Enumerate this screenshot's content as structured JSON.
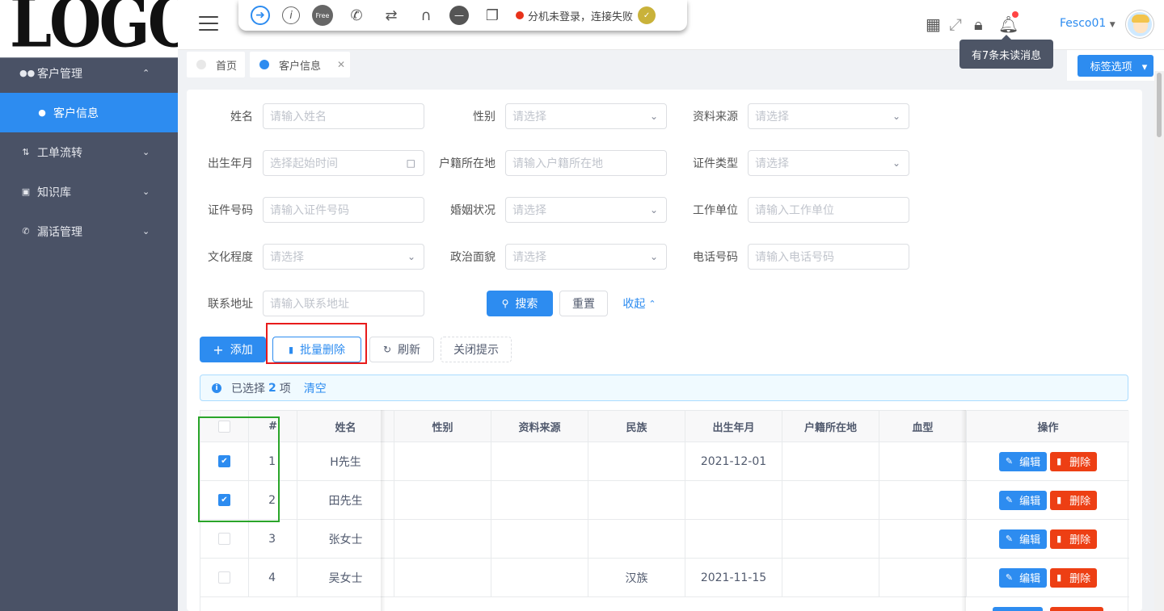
{
  "logo": "LOGO",
  "sidebar": {
    "items": [
      {
        "label": "客户管理",
        "icon": "users-icon"
      },
      {
        "label": "客户信息",
        "icon": "user-plus-icon"
      },
      {
        "label": "工单流转",
        "icon": "transfer-icon"
      },
      {
        "label": "知识库",
        "icon": "book-icon"
      },
      {
        "label": "漏话管理",
        "icon": "phone-icon"
      }
    ]
  },
  "phonebar": {
    "status": "分机未登录，连接失败",
    "free_label": "Free"
  },
  "header": {
    "user": "Fesco01",
    "tooltip": "有7条未读消息"
  },
  "tabs": [
    {
      "label": "首页"
    },
    {
      "label": "客户信息"
    }
  ],
  "tag_options": "标签选项",
  "form": {
    "name": {
      "label": "姓名",
      "placeholder": "请输入姓名"
    },
    "gender": {
      "label": "性别",
      "placeholder": "请选择"
    },
    "source": {
      "label": "资料来源",
      "placeholder": "请选择"
    },
    "birth": {
      "label": "出生年月",
      "placeholder": "选择起始时间"
    },
    "hukou": {
      "label": "户籍所在地",
      "placeholder": "请输入户籍所在地"
    },
    "idtype": {
      "label": "证件类型",
      "placeholder": "请选择"
    },
    "idno": {
      "label": "证件号码",
      "placeholder": "请输入证件号码"
    },
    "marital": {
      "label": "婚姻状况",
      "placeholder": "请选择"
    },
    "work": {
      "label": "工作单位",
      "placeholder": "请输入工作单位"
    },
    "edu": {
      "label": "文化程度",
      "placeholder": "请选择"
    },
    "politics": {
      "label": "政治面貌",
      "placeholder": "请选择"
    },
    "phone": {
      "label": "电话号码",
      "placeholder": "请输入电话号码"
    },
    "address": {
      "label": "联系地址",
      "placeholder": "请输入联系地址"
    },
    "search": "搜索",
    "reset": "重置",
    "collapse": "收起"
  },
  "toolbar": {
    "add": "添加",
    "batch_delete": "批量删除",
    "refresh": "刷新",
    "close_tip": "关闭提示"
  },
  "alert": {
    "prefix": "已选择",
    "count": "2",
    "suffix": "项",
    "clear": "清空"
  },
  "table": {
    "columns": [
      "#",
      "姓名",
      "性别",
      "资料来源",
      "民族",
      "出生年月",
      "户籍所在地",
      "血型",
      "操作"
    ],
    "edit": "编辑",
    "delete": "删除",
    "rows": [
      {
        "idx": "1",
        "name": "H先生",
        "gender": "",
        "source": "",
        "nation": "",
        "birth": "2021-12-01",
        "hukou": "",
        "blood": "",
        "checked": true
      },
      {
        "idx": "2",
        "name": "田先生",
        "gender": "",
        "source": "",
        "nation": "",
        "birth": "",
        "hukou": "",
        "blood": "",
        "checked": true
      },
      {
        "idx": "3",
        "name": "张女士",
        "gender": "",
        "source": "",
        "nation": "",
        "birth": "",
        "hukou": "",
        "blood": "",
        "checked": false
      },
      {
        "idx": "4",
        "name": "吴女士",
        "gender": "",
        "source": "",
        "nation": "汉族",
        "birth": "2021-11-15",
        "hukou": "",
        "blood": "",
        "checked": false
      }
    ]
  }
}
